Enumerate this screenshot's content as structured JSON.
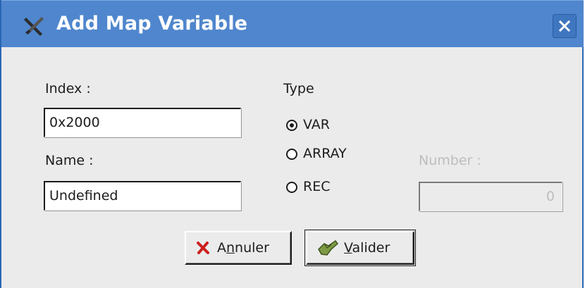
{
  "window": {
    "title": "Add Map Variable",
    "app_icon": "tools-icon",
    "close_icon": "close-icon"
  },
  "form": {
    "index_label": "Index :",
    "index_value": "0x2000",
    "name_label": "Name :",
    "name_value": "Undefined",
    "type_label": "Type",
    "type_options": [
      "VAR",
      "ARRAY",
      "REC"
    ],
    "type_selected": "VAR",
    "number_label": "Number :",
    "number_value": "0",
    "number_enabled": false
  },
  "buttons": {
    "cancel": {
      "pre": "A",
      "mnemonic": "n",
      "post": "nuler",
      "icon": "cancel-x-icon"
    },
    "ok": {
      "pre": "",
      "mnemonic": "V",
      "post": "alider",
      "icon": "check-hand-icon"
    }
  },
  "colors": {
    "titlebar": "#4f86cd",
    "dialog_bg": "#ebebeb",
    "cancel_icon": "#cc1f1f",
    "ok_icon": "#6f8a3d"
  }
}
